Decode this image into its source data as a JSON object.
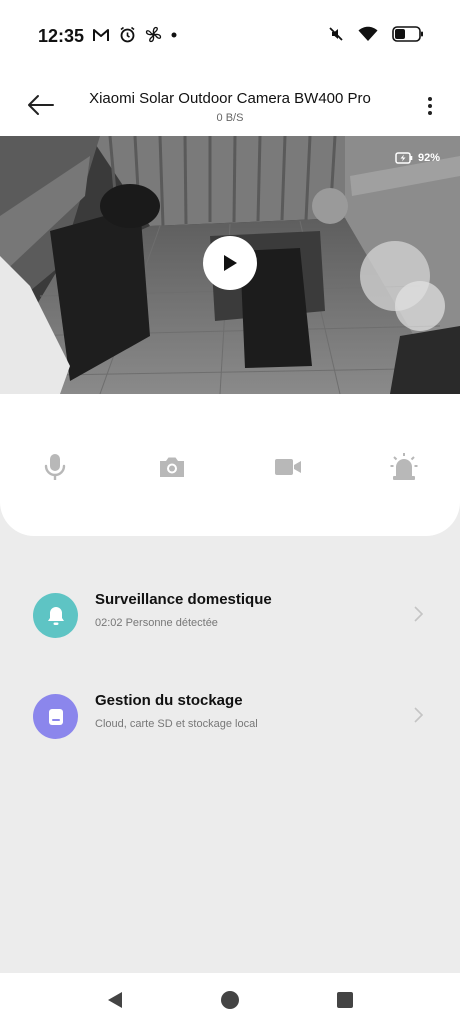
{
  "status_bar": {
    "time": "12:35",
    "left_icons": [
      "gmail-icon",
      "alarm-icon",
      "fan-icon",
      "dot-icon"
    ],
    "right_icons": [
      "mute-icon",
      "wifi-icon",
      "battery-icon"
    ]
  },
  "header": {
    "title": "Xiaomi Solar Outdoor Camera BW400 Pro",
    "speed": "0 B/S"
  },
  "video": {
    "battery_percent": "92%",
    "playing": false
  },
  "controls": [
    "microphone-icon",
    "camera-icon",
    "video-record-icon",
    "alarm-siren-icon"
  ],
  "list": [
    {
      "title": "Surveillance domestique",
      "subtitle": "02:02 Personne détectée",
      "icon": "bell-icon",
      "color": "#5ec4c4"
    },
    {
      "title": "Gestion du stockage",
      "subtitle": "Cloud, carte SD et stockage local",
      "icon": "storage-icon",
      "color": "#8b86ec"
    }
  ],
  "colors": {
    "accent_teal": "#5ec4c4",
    "accent_purple": "#8b86ec",
    "control_icon_gray": "#b8b8b8",
    "background": "#ececec"
  }
}
